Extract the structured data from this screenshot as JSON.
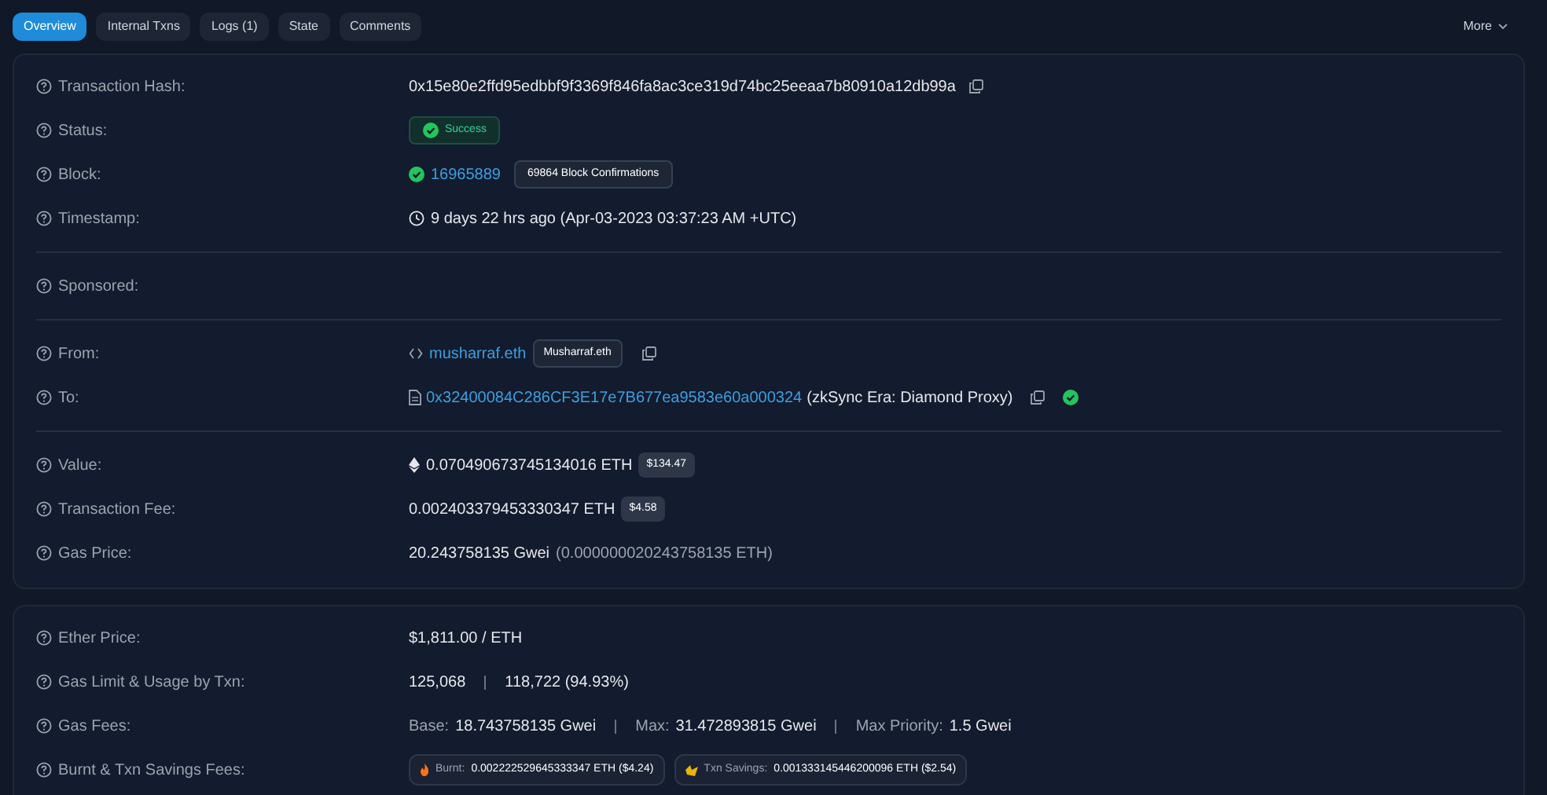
{
  "tabs": [
    {
      "label": "Overview",
      "selected": true
    },
    {
      "label": "Internal Txns",
      "selected": false
    },
    {
      "label": "Logs (1)",
      "selected": false
    },
    {
      "label": "State",
      "selected": false
    },
    {
      "label": "Comments",
      "selected": false
    }
  ],
  "more": {
    "label": "More"
  },
  "cards": [
    {
      "groups": [
        [
          {
            "label": "Transaction Hash:",
            "kind": "hash",
            "text": "0x15e80e2ffd95edbbf9f3369f846fa8ac3ce319d74bc25eeaa7b80910a12db99a"
          },
          {
            "label": "Status:",
            "kind": "status",
            "badge": "Success"
          },
          {
            "label": "Block:",
            "kind": "block",
            "number": "16965889",
            "confirmations": "69864 Block Confirmations"
          },
          {
            "label": "Timestamp:",
            "kind": "time",
            "text": "9 days 22 hrs ago (Apr-03-2023 03:37:23 AM +UTC)"
          }
        ],
        [
          {
            "label": "Sponsored:",
            "kind": "empty"
          }
        ],
        [
          {
            "label": "From:",
            "kind": "from",
            "link": "musharraf.eth",
            "tag": "Musharraf.eth"
          },
          {
            "label": "To:",
            "kind": "to",
            "link": "0x32400084C286CF3E17e7B677ea9583e60a000324",
            "name": "(zkSync Era: Diamond Proxy)"
          }
        ],
        [
          {
            "label": "Value:",
            "kind": "eth_amount",
            "text": "0.070490673745134016 ETH",
            "usd": "$134.47"
          },
          {
            "label": "Transaction Fee:",
            "kind": "amount",
            "text": "0.002403379453330347 ETH",
            "usd": "$4.58"
          },
          {
            "label": "Gas Price:",
            "kind": "gasprice",
            "text": "20.243758135 Gwei",
            "sub": "(0.000000020243758135 ETH)"
          }
        ]
      ]
    },
    {
      "groups": [
        [
          {
            "label": "Ether Price:",
            "kind": "plain",
            "text": "$1,811.00 / ETH"
          },
          {
            "label": "Gas Limit & Usage by Txn:",
            "kind": "pipe",
            "parts": [
              "125,068",
              "118,722 (94.93%)"
            ]
          },
          {
            "label": "Gas Fees:",
            "kind": "fees",
            "parts": [
              {
                "label": "Base:",
                "value": "18.743758135 Gwei"
              },
              {
                "label": "Max:",
                "value": "31.472893815 Gwei"
              },
              {
                "label": "Max Priority:",
                "value": "1.5 Gwei"
              }
            ]
          },
          {
            "label": "Burnt & Txn Savings Fees:",
            "kind": "pills",
            "pills": [
              {
                "kind": "fire",
                "label": "Burnt:",
                "value": "0.002222529645333347 ETH ($4.24)"
              },
              {
                "kind": "savings",
                "label": "Txn Savings:",
                "value": "0.001333145446200096 ETH ($2.54)"
              }
            ]
          }
        ]
      ]
    }
  ]
}
